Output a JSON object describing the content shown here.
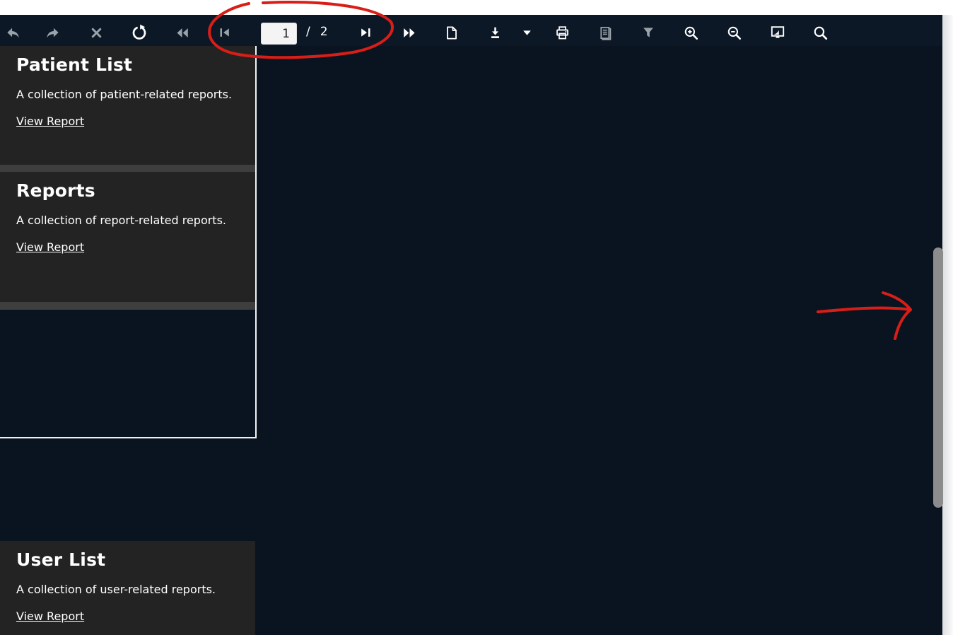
{
  "toolbar": {
    "page_input_value": "1",
    "page_separator": "/",
    "page_total": "2",
    "buttons": [
      {
        "icon": "back-icon",
        "color": "#9aa2aa"
      },
      {
        "icon": "forward-icon",
        "color": "#9aa2aa"
      },
      {
        "icon": "close-icon",
        "color": "#9aa2aa"
      },
      {
        "icon": "refresh-icon",
        "color": "#ffffff"
      },
      {
        "icon": "rewind-icon",
        "color": "#9aa2aa"
      },
      {
        "icon": "first-page-icon",
        "color": "#9aa2aa"
      },
      {
        "icon": "next-page-icon",
        "color": "#ffffff"
      },
      {
        "icon": "fast-forward-icon",
        "color": "#ffffff"
      },
      {
        "icon": "document-icon",
        "color": "#ffffff"
      },
      {
        "icon": "download-icon",
        "color": "#ffffff"
      },
      {
        "icon": "caret-down-icon",
        "color": "#ffffff"
      },
      {
        "icon": "print-icon",
        "color": "#ffffff"
      },
      {
        "icon": "print-layout-icon",
        "color": "#9aa2aa"
      },
      {
        "icon": "filter-icon",
        "color": "#9aa2aa"
      },
      {
        "icon": "zoom-in-icon",
        "color": "#ffffff"
      },
      {
        "icon": "zoom-out-icon",
        "color": "#ffffff"
      },
      {
        "icon": "fit-screen-icon",
        "color": "#ffffff"
      },
      {
        "icon": "search-icon",
        "color": "#ffffff"
      }
    ]
  },
  "cards": [
    {
      "title": "Patient List",
      "description": "A collection of patient-related reports.",
      "link": "View Report"
    },
    {
      "title": "Reports",
      "description": "A collection of report-related reports.",
      "link": "View Report"
    },
    {
      "title": "User List",
      "description": "A collection of user-related reports.",
      "link": "View Report"
    }
  ],
  "colors": {
    "annotation_red": "#d81e17",
    "toolbar_bg": "#0d1826",
    "page_bg": "#0a1420",
    "card_bg": "#232323",
    "separator": "#3e3e3e",
    "page_border": "#f2f2f2",
    "scrollbar_thumb": "#8c8c8c",
    "icon_gray": "#9aa2aa",
    "icon_white": "#ffffff"
  }
}
